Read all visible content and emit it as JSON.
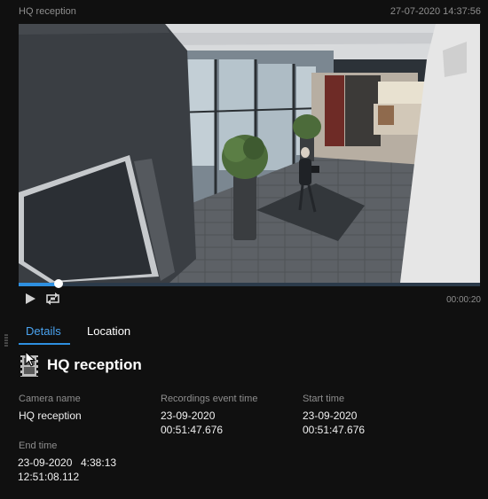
{
  "header": {
    "title": "HQ reception",
    "timestamp": "27-07-2020 14:37:56"
  },
  "playback": {
    "elapsed": "00:00:20",
    "progress": 0.086
  },
  "tabs": [
    {
      "label": "Details"
    },
    {
      "label": "Location"
    }
  ],
  "camera": {
    "title": "HQ reception"
  },
  "details": {
    "camera_name_label": "Camera name",
    "camera_name": "HQ reception",
    "recordings_event_time_label": "Recordings event time",
    "recordings_event_date": "23-09-2020",
    "recordings_event_time": "00:51:47.676",
    "start_time_label": "Start time",
    "start_date": "23-09-2020",
    "start_time": "00:51:47.676",
    "end_time_label": "End time",
    "end_date": "23-09-2020",
    "end_time": "12:51:08.112",
    "end_overlap": "4:38:13"
  },
  "icons": {
    "play": "play-icon",
    "loop": "loop-icon",
    "camera": "film-camera-icon",
    "grip": "drag-grip-icon",
    "cursor": "mouse-cursor-icon"
  },
  "colors": {
    "accent": "#2e8fe0",
    "background": "#101010",
    "muted_text": "#8e8e8e"
  }
}
